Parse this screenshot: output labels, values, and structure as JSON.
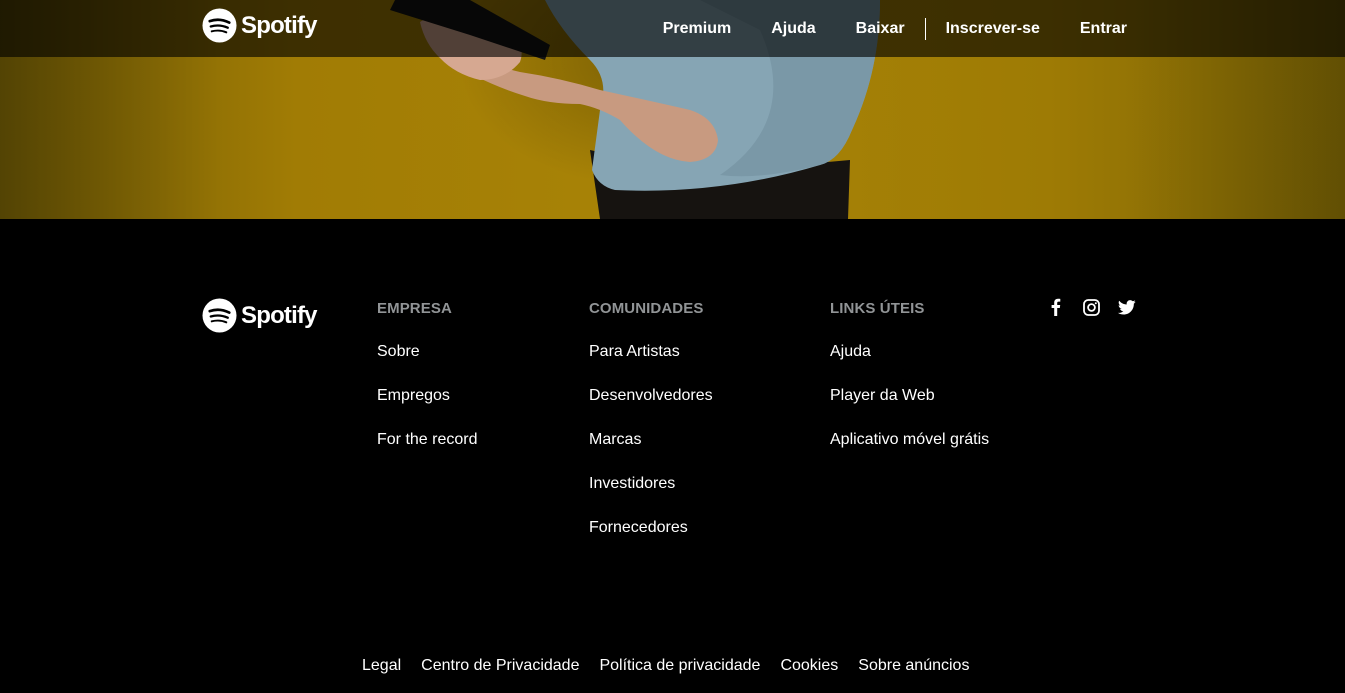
{
  "brand": {
    "name": "Spotify",
    "tm": "®",
    "accent": "#ffffff",
    "hero_color": "#a98406"
  },
  "nav": {
    "links": [
      "Premium",
      "Ajuda",
      "Baixar"
    ],
    "account_links": [
      "Inscrever-se",
      "Entrar"
    ]
  },
  "footer": {
    "columns": [
      {
        "title": "EMPRESA",
        "links": [
          "Sobre",
          "Empregos",
          "For the record"
        ]
      },
      {
        "title": "COMUNIDADES",
        "links": [
          "Para Artistas",
          "Desenvolvedores",
          "Marcas",
          "Investidores",
          "Fornecedores"
        ]
      },
      {
        "title": "LINKS ÚTEIS",
        "links": [
          "Ajuda",
          "Player da Web",
          "Aplicativo móvel grátis"
        ]
      }
    ],
    "social": [
      "facebook-icon",
      "instagram-icon",
      "twitter-icon"
    ],
    "legal": [
      "Legal",
      "Centro de Privacidade",
      "Política de privacidade",
      "Cookies",
      "Sobre anúncios"
    ]
  }
}
